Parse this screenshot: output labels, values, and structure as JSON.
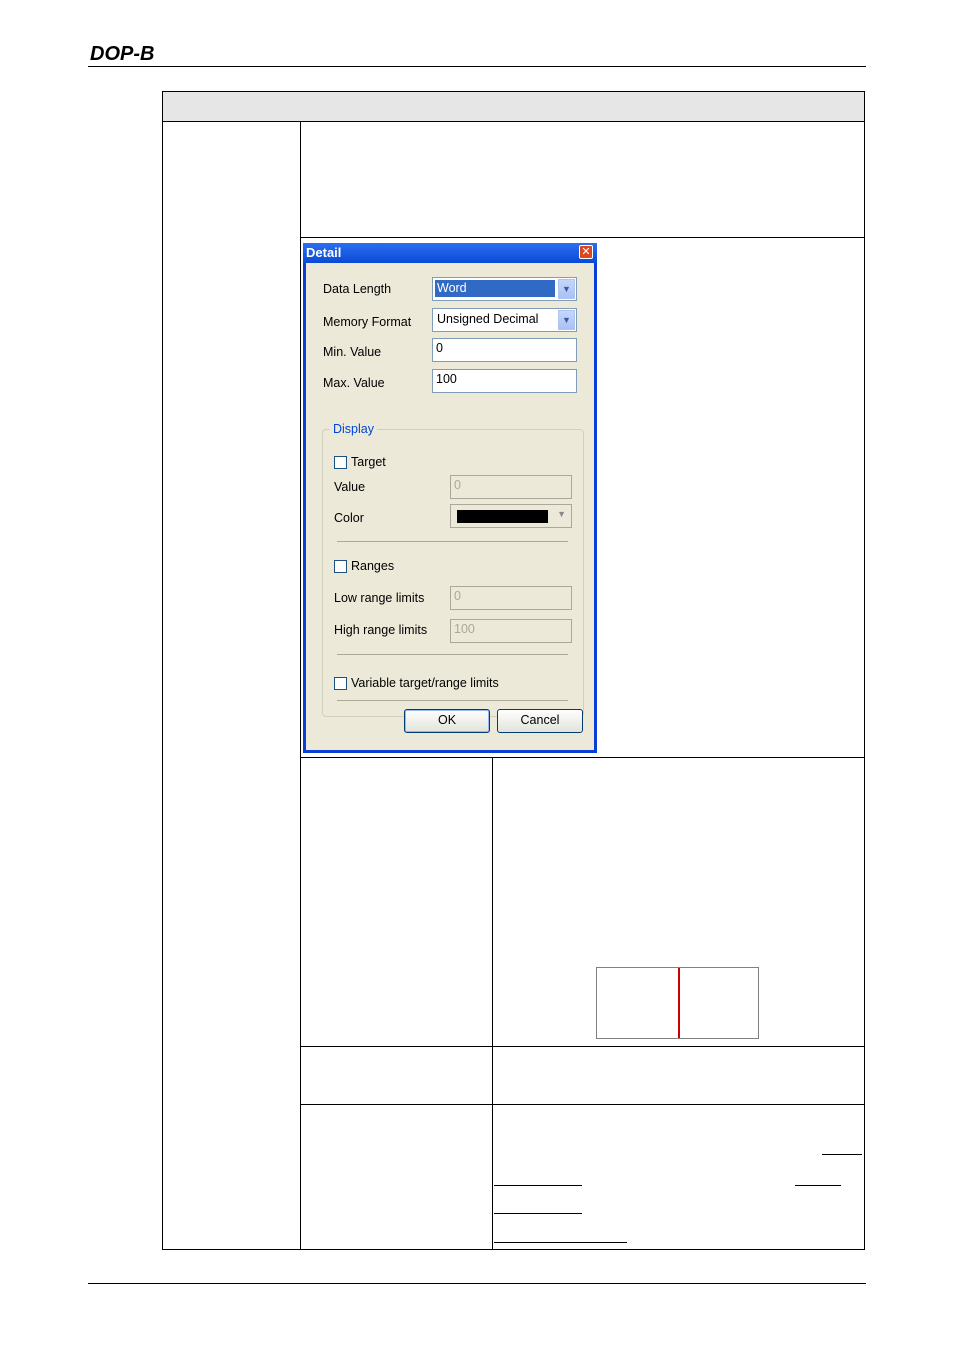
{
  "header": {
    "logo_text": "DOP-B"
  },
  "dialog": {
    "title": "Detail",
    "close_symbol": "✕",
    "fields": {
      "data_length": {
        "label": "Data Length",
        "value": "Word"
      },
      "memory_format": {
        "label": "Memory Format",
        "value": "Unsigned Decimal"
      },
      "min_value": {
        "label": "Min. Value",
        "value": "0"
      },
      "max_value": {
        "label": "Max. Value",
        "value": "100"
      }
    },
    "display_group": {
      "title": "Display",
      "target": {
        "label": "Target",
        "checked": false
      },
      "value": {
        "label": "Value",
        "value": "0"
      },
      "color": {
        "label": "Color",
        "value": "#000000"
      },
      "ranges": {
        "label": "Ranges",
        "checked": false
      },
      "low_range": {
        "label": "Low range limits",
        "value": "0"
      },
      "high_range": {
        "label": "High range limits",
        "value": "100"
      },
      "variable_limits": {
        "label": "Variable target/range limits",
        "checked": false
      }
    },
    "buttons": {
      "ok": "OK",
      "cancel": "Cancel"
    }
  },
  "colors": {
    "needle": "#cc0000",
    "title_bar": "#0a4ad6",
    "dialog_bg": "#ece9d8"
  },
  "icons": [
    "close-icon",
    "chevron-down-icon"
  ]
}
